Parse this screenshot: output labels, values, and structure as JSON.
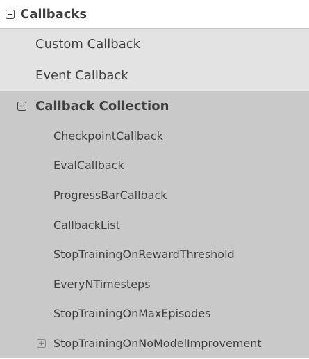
{
  "nav": {
    "section": {
      "label": "Callbacks",
      "state": "expanded",
      "icon": "collapse-icon"
    },
    "items": [
      {
        "label": "Custom Callback"
      },
      {
        "label": "Event Callback"
      }
    ],
    "group": {
      "label": "Callback Collection",
      "state": "expanded",
      "icon": "collapse-icon",
      "children": [
        {
          "label": "CheckpointCallback"
        },
        {
          "label": "EvalCallback"
        },
        {
          "label": "ProgressBarCallback"
        },
        {
          "label": "CallbackList"
        },
        {
          "label": "StopTrainingOnRewardThreshold"
        },
        {
          "label": "EveryNTimesteps"
        },
        {
          "label": "StopTrainingOnMaxEpisodes"
        },
        {
          "label": "StopTrainingOnNoModelImprovement",
          "icon": "expand-icon",
          "state": "collapsed"
        }
      ]
    }
  },
  "colors": {
    "level1_bg": "#ffffff",
    "level2_bg": "#e3e3e3",
    "level3_bg": "#c9c9c9",
    "text": "#404040"
  }
}
